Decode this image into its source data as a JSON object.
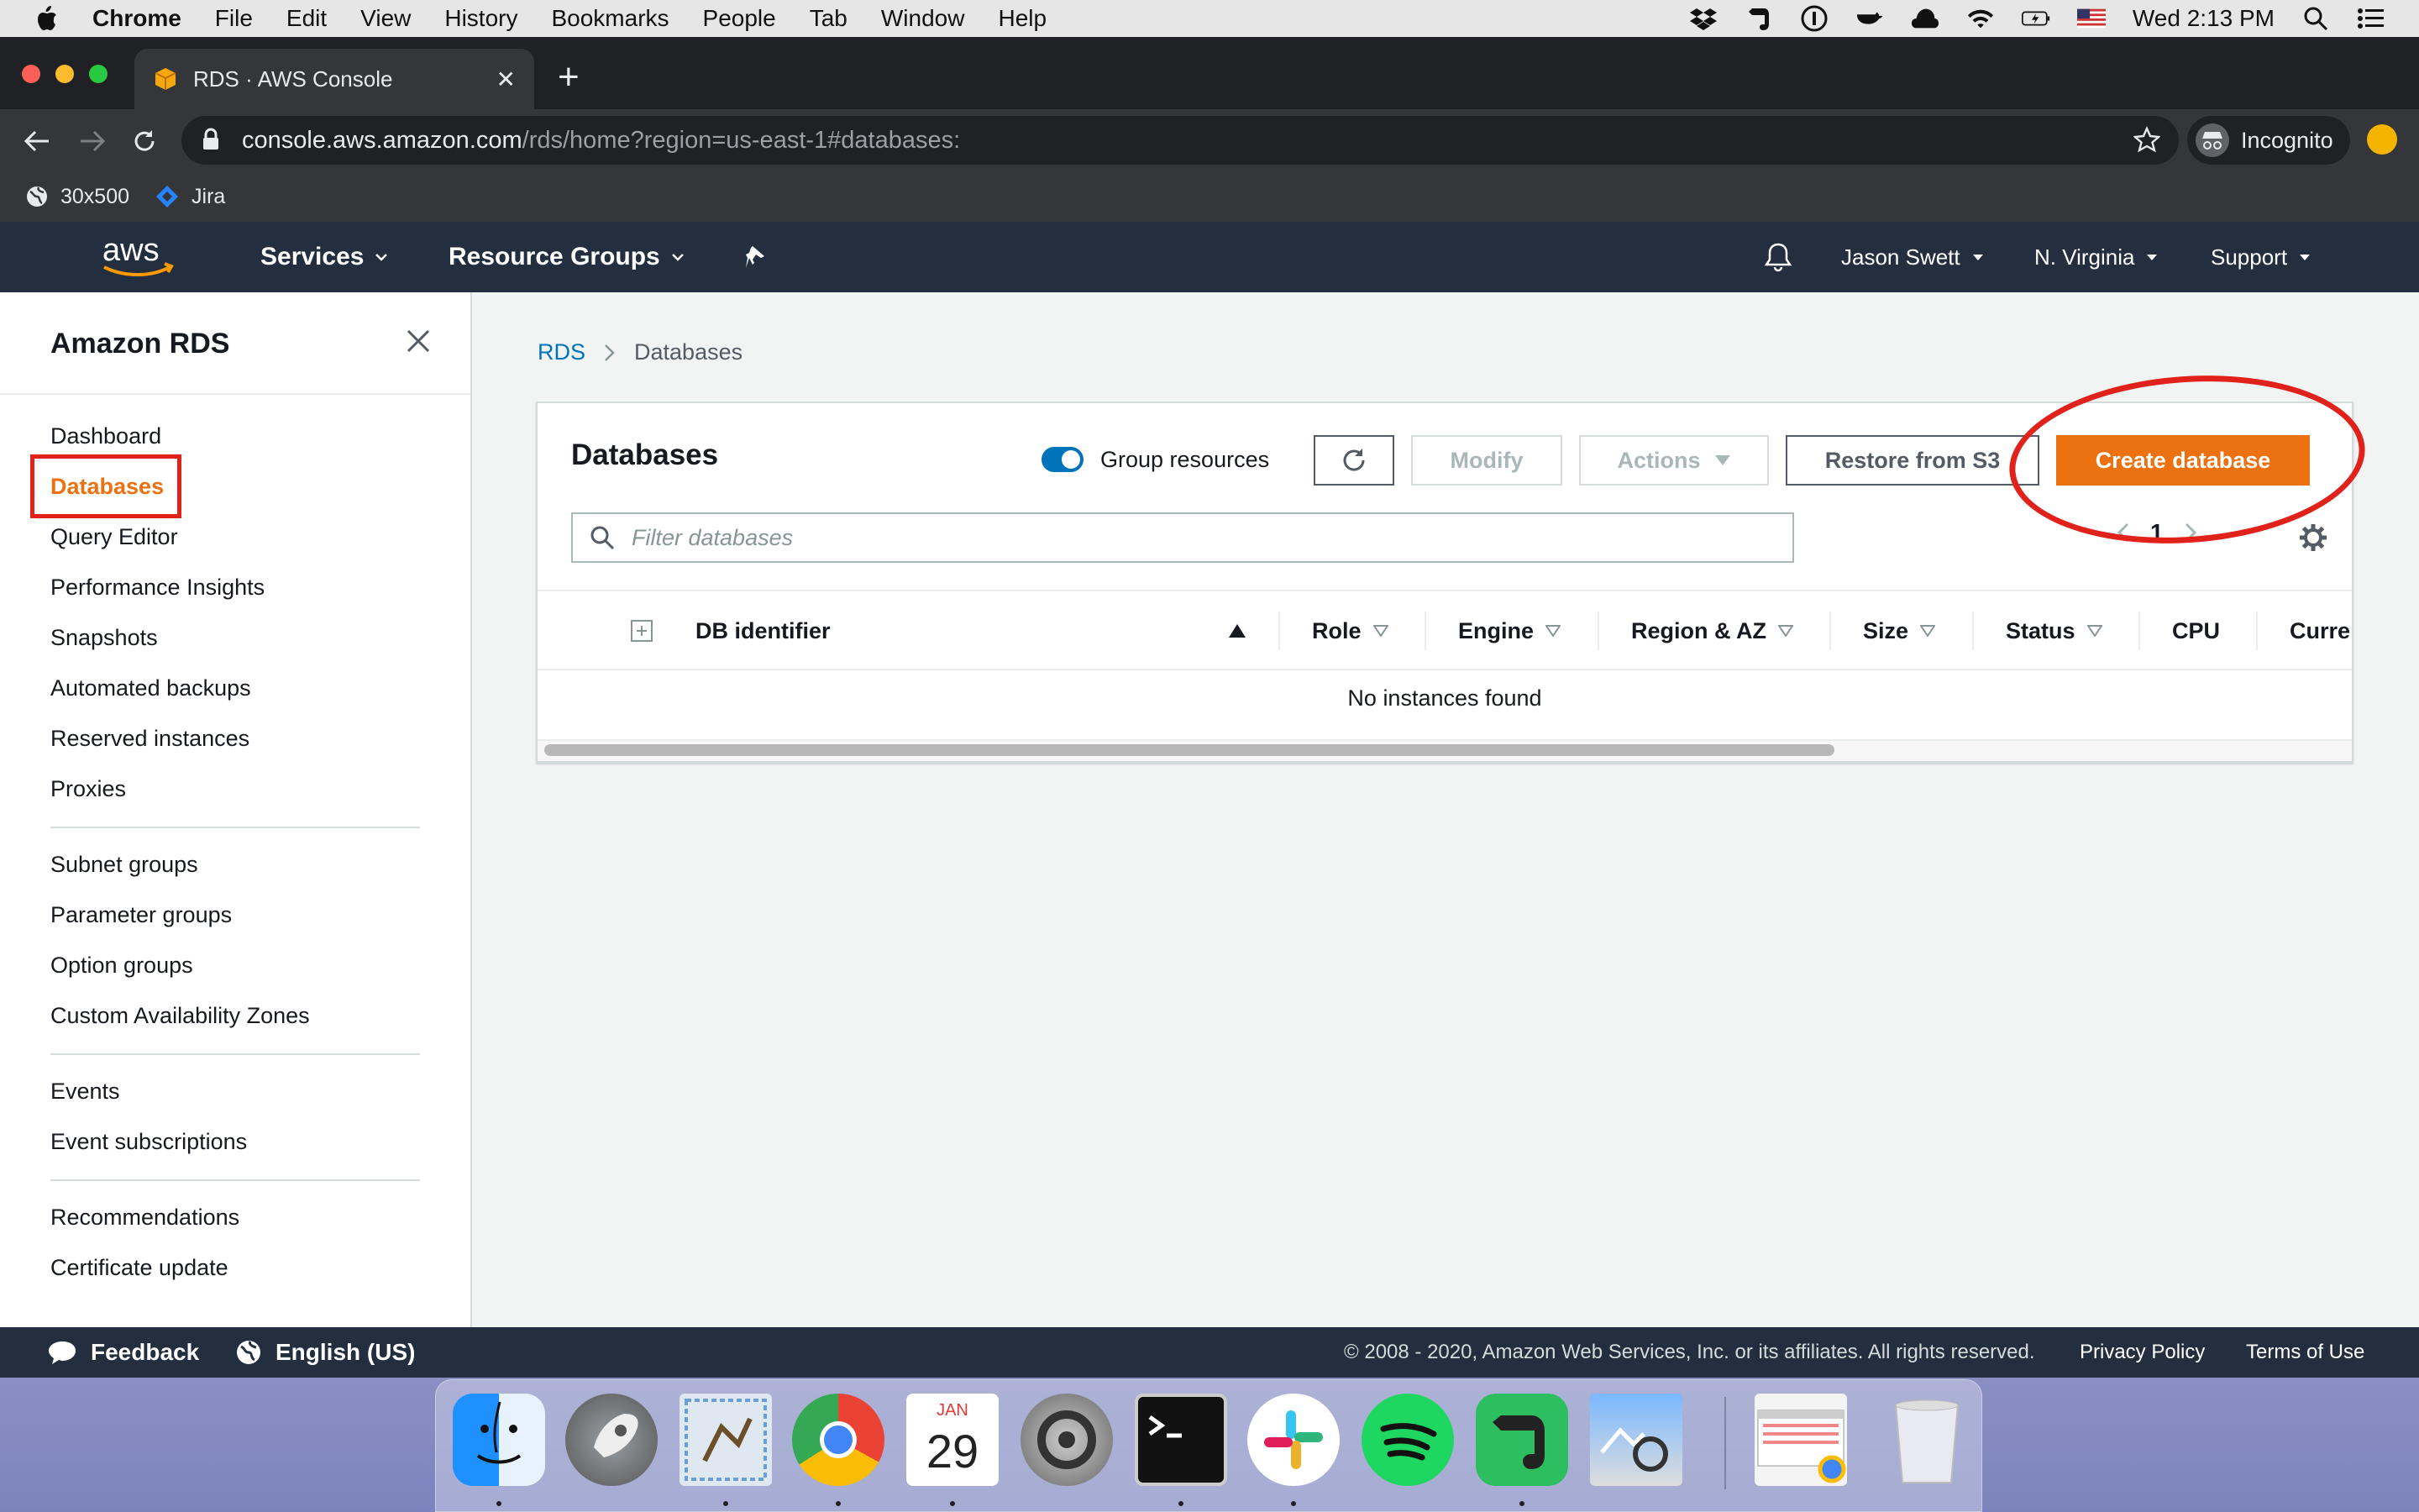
{
  "menubar": {
    "app": "Chrome",
    "items": [
      "File",
      "Edit",
      "View",
      "History",
      "Bookmarks",
      "People",
      "Tab",
      "Window",
      "Help"
    ],
    "clock": "Wed 2:13 PM"
  },
  "browser": {
    "tab_title": "RDS · AWS Console",
    "url_host": "console.aws.amazon.com",
    "url_path": "/rds/home?region=us-east-1#databases:",
    "profile": "Incognito",
    "bookmarks": [
      "30x500",
      "Jira"
    ]
  },
  "awsnav": {
    "services": "Services",
    "resource_groups": "Resource Groups",
    "user": "Jason Swett",
    "region": "N. Virginia",
    "support": "Support"
  },
  "sidebar": {
    "title": "Amazon RDS",
    "group1": [
      "Dashboard",
      "Databases",
      "Query Editor",
      "Performance Insights",
      "Snapshots",
      "Automated backups",
      "Reserved instances",
      "Proxies"
    ],
    "group2": [
      "Subnet groups",
      "Parameter groups",
      "Option groups",
      "Custom Availability Zones"
    ],
    "group3": [
      "Events",
      "Event subscriptions"
    ],
    "group4": [
      "Recommendations",
      "Certificate update"
    ],
    "active": "Databases"
  },
  "breadcrumb": {
    "root": "RDS",
    "current": "Databases"
  },
  "panel": {
    "title": "Databases",
    "group_resources": "Group resources",
    "modify": "Modify",
    "actions": "Actions",
    "restore": "Restore from S3",
    "create": "Create database",
    "filter_placeholder": "Filter databases",
    "page": "1",
    "columns": [
      "DB identifier",
      "Role",
      "Engine",
      "Region & AZ",
      "Size",
      "Status",
      "CPU",
      "Curre"
    ],
    "empty": "No instances found"
  },
  "footer": {
    "feedback": "Feedback",
    "language": "English (US)",
    "copyright": "© 2008 - 2020, Amazon Web Services, Inc. or its affiliates. All rights reserved.",
    "privacy": "Privacy Policy",
    "terms": "Terms of Use"
  },
  "dock": {
    "calendar_month": "JAN",
    "calendar_day": "29"
  },
  "colors": {
    "aws_nav": "#232f3e",
    "accent_orange": "#ec7211",
    "link_blue": "#0073bb",
    "annotation_red": "#e0221a"
  }
}
